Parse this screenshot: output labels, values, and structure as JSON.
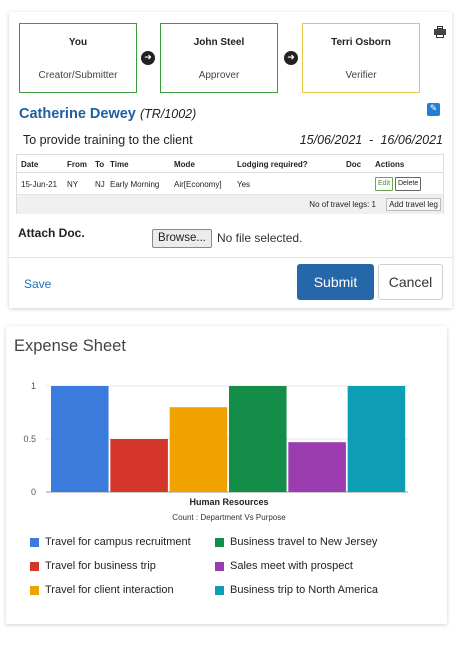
{
  "workflow": {
    "steps": [
      {
        "name": "You",
        "role": "Creator/Submitter",
        "color": "#3a9e3a"
      },
      {
        "name": "John Steel",
        "role": "Approver",
        "color": "#3a9e3a"
      },
      {
        "name": "Terri Osborn",
        "role": "Verifier",
        "color": "#e8c64a"
      }
    ],
    "arrow_icon": "arrow-right-circle-icon",
    "print_icon": "printer-icon"
  },
  "request": {
    "employee_name": "Catherine Dewey",
    "employee_code": "(TR/1002)",
    "purpose": "To provide training to the client",
    "date_from": "15/06/2021",
    "date_separator": "-",
    "date_to": "16/06/2021"
  },
  "legs": {
    "headers": [
      "Date",
      "From",
      "To",
      "Time",
      "Mode",
      "Lodging required?",
      "Doc",
      "Actions"
    ],
    "rows": [
      {
        "date": "15-Jun-21",
        "from": "NY",
        "to": "NJ",
        "time": "Early Morning",
        "mode": "Air[Economy]",
        "lodging": "Yes",
        "doc": "",
        "edit_label": "Edit",
        "delete_label": "Delete"
      }
    ],
    "count_text": "No of travel legs: 1",
    "add_label": "Add travel leg"
  },
  "attach": {
    "label": "Attach Doc.",
    "browse_label": "Browse...",
    "file_status": "No file selected."
  },
  "actions": {
    "save_label": "Save",
    "submit_label": "Submit",
    "cancel_label": "Cancel"
  },
  "chart_title": "Expense Sheet",
  "chart_data": {
    "type": "bar",
    "categories": [
      "Human Resources"
    ],
    "xlabel": "Human Resources",
    "subtitle": "Count : Department Vs Purpose",
    "ylim": [
      0,
      1
    ],
    "yticks": [
      0,
      0.5,
      1
    ],
    "ytick_labels": [
      "0",
      "0.5",
      "1"
    ],
    "series": [
      {
        "name": "Travel for campus recruitment",
        "values": [
          1
        ],
        "color": "#3a7bdc"
      },
      {
        "name": "Travel for business trip",
        "values": [
          0.5
        ],
        "color": "#d4362c"
      },
      {
        "name": "Travel for client interaction",
        "values": [
          0.8
        ],
        "color": "#f0a200"
      },
      {
        "name": "Business travel to New Jersey",
        "values": [
          1
        ],
        "color": "#138d48"
      },
      {
        "name": "Sales meet with prospect",
        "values": [
          0.47
        ],
        "color": "#9a3bb0"
      },
      {
        "name": "Business trip to North America",
        "values": [
          1
        ],
        "color": "#0d9db5"
      }
    ]
  }
}
